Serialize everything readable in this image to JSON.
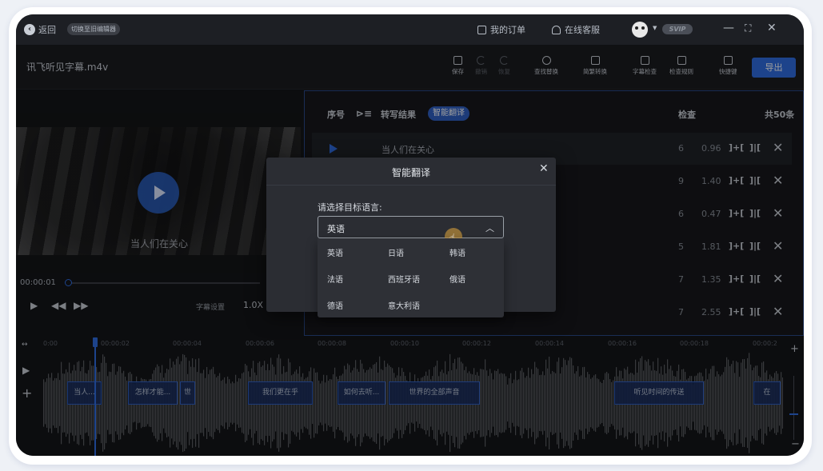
{
  "topbar": {
    "back_label": "返回",
    "switch_label": "切换至旧编辑器",
    "orders_label": "我的订单",
    "support_label": "在线客服",
    "svip_label": "SVIP"
  },
  "toolbar": {
    "filename": "讯飞听见字幕.m4v",
    "save": "保存",
    "undo": "撤销",
    "redo": "恢复",
    "find_replace": "查找替换",
    "convert": "简繁转换",
    "subtitle_check": "字幕检查",
    "check_rules": "检查规则",
    "shortcuts": "快捷键",
    "export": "导出"
  },
  "player": {
    "subtitle": "当人们在关心",
    "current_time": "00:00:01",
    "subtitle_settings": "字幕设置",
    "speed": "1.0X",
    "progress": 0.0
  },
  "list": {
    "col_index": "序号",
    "col_result": "转写结果",
    "tag": "智能翻译",
    "col_check": "检查",
    "total": "共50条",
    "rows": [
      {
        "text": "当人们在关心",
        "num": "6",
        "dur": "0.96"
      },
      {
        "text": "",
        "num": "9",
        "dur": "1.40"
      },
      {
        "text": "",
        "num": "6",
        "dur": "0.47"
      },
      {
        "text": "",
        "num": "5",
        "dur": "1.81"
      },
      {
        "text": "",
        "num": "7",
        "dur": "1.35"
      },
      {
        "text": "",
        "num": "7",
        "dur": "2.55"
      }
    ],
    "merge_glyph": "]+[",
    "split_glyph": "]|["
  },
  "timeline": {
    "ticks": [
      "0:00",
      "00:00:02",
      "00:00:04",
      "00:00:06",
      "00:00:08",
      "00:00:10",
      "00:00:12",
      "00:00:14",
      "00:00:16",
      "00:00:18",
      "00:00:2"
    ],
    "segments": [
      "当人...",
      "怎样才能...",
      "世",
      "我们更在乎",
      "如何去听...",
      "世界的全部声音",
      "听见时间的传送",
      "在"
    ]
  },
  "modal": {
    "title": "智能翻译",
    "label": "请选择目标语言:",
    "selected": "英语",
    "options": [
      "英语",
      "日语",
      "韩语",
      "法语",
      "西班牙语",
      "俄语",
      "德语",
      "意大利语"
    ]
  },
  "colors": {
    "accent": "#2f6de0",
    "background": "#141519",
    "modal": "#2b2d33"
  }
}
